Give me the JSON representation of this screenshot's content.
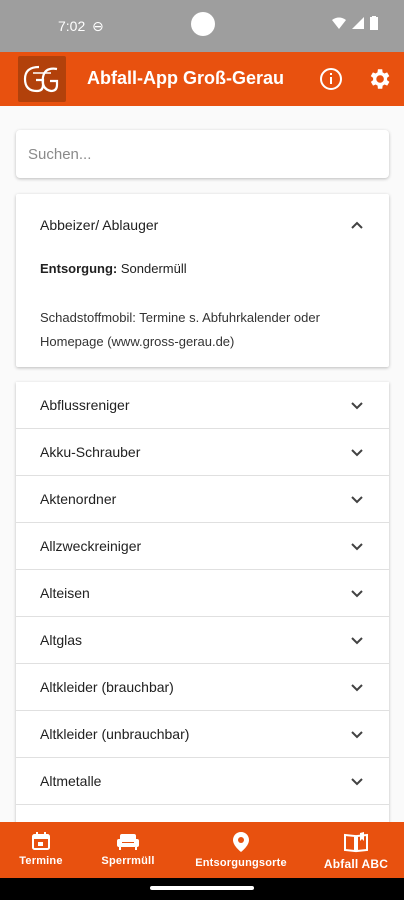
{
  "status_bar": {
    "time": "7:02"
  },
  "app_bar": {
    "title": "Abfall-App Groß-Gerau",
    "logo_text": "GG"
  },
  "search": {
    "placeholder": "Suchen..."
  },
  "expanded": {
    "title": "Abbeizer/ Ablauger",
    "disposal_label": "Entsorgung:",
    "disposal_value": "Sondermüll",
    "note": "Schadstoffmobil: Termine s. Abfuhrkalender oder Homepage (www.gross-gerau.de)"
  },
  "items": [
    {
      "label": "Abflussreniger"
    },
    {
      "label": "Akku-Schrauber"
    },
    {
      "label": "Aktenordner"
    },
    {
      "label": "Allzweckreiniger"
    },
    {
      "label": "Alteisen"
    },
    {
      "label": "Altglas"
    },
    {
      "label": "Altkleider (brauchbar)"
    },
    {
      "label": "Altkleider (unbrauchbar)"
    },
    {
      "label": "Altmetalle"
    },
    {
      "label": ""
    }
  ],
  "bottom_nav": [
    {
      "label": "Termine",
      "icon": "calendar-icon",
      "active": false
    },
    {
      "label": "Sperrmüll",
      "icon": "sofa-icon",
      "active": false
    },
    {
      "label": "Entsorgungsorte",
      "icon": "location-pin-icon",
      "active": false
    },
    {
      "label": "Abfall ABC",
      "icon": "book-icon",
      "active": true
    }
  ],
  "colors": {
    "primary": "#e8510f",
    "status_bar": "#9e9e9e",
    "background": "#fafafa"
  }
}
